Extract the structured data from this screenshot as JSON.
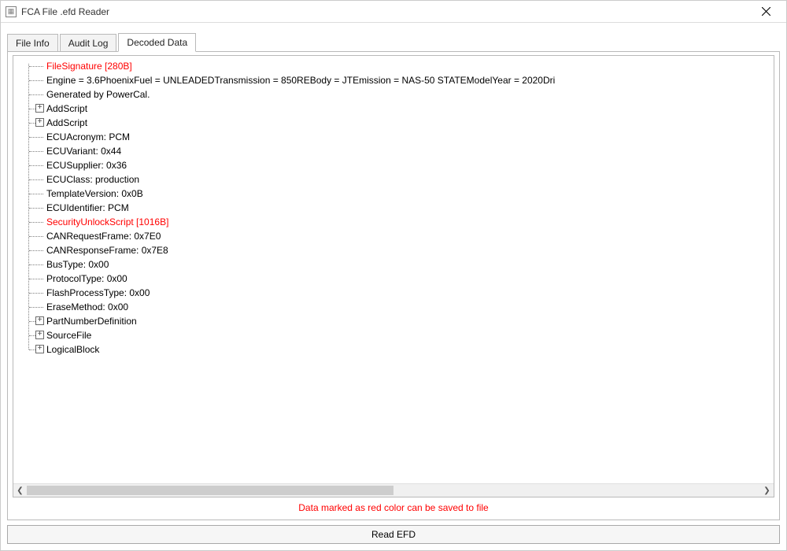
{
  "window": {
    "title": "FCA File .efd Reader"
  },
  "tabs": [
    {
      "label": "File Info",
      "active": false
    },
    {
      "label": "Audit Log",
      "active": false
    },
    {
      "label": "Decoded Data",
      "active": true
    }
  ],
  "tree": [
    {
      "text": "FileSignature [280B]",
      "red": true,
      "expandable": false
    },
    {
      "text": "Engine = 3.6PhoenixFuel = UNLEADEDTransmission = 850REBody = JTEmission = NAS-50 STATEModelYear = 2020Dri",
      "red": false,
      "expandable": false
    },
    {
      "text": "Generated by PowerCal.",
      "red": false,
      "expandable": false
    },
    {
      "text": "AddScript",
      "red": false,
      "expandable": true
    },
    {
      "text": "AddScript",
      "red": false,
      "expandable": true
    },
    {
      "text": "ECUAcronym: PCM",
      "red": false,
      "expandable": false
    },
    {
      "text": "ECUVariant: 0x44",
      "red": false,
      "expandable": false
    },
    {
      "text": "ECUSupplier: 0x36",
      "red": false,
      "expandable": false
    },
    {
      "text": "ECUClass: production",
      "red": false,
      "expandable": false
    },
    {
      "text": "TemplateVersion: 0x0B",
      "red": false,
      "expandable": false
    },
    {
      "text": "ECUIdentifier: PCM",
      "red": false,
      "expandable": false
    },
    {
      "text": "SecurityUnlockScript [1016B]",
      "red": true,
      "expandable": false
    },
    {
      "text": "CANRequestFrame: 0x7E0",
      "red": false,
      "expandable": false
    },
    {
      "text": "CANResponseFrame: 0x7E8",
      "red": false,
      "expandable": false
    },
    {
      "text": "BusType: 0x00",
      "red": false,
      "expandable": false
    },
    {
      "text": "ProtocolType: 0x00",
      "red": false,
      "expandable": false
    },
    {
      "text": "FlashProcessType: 0x00",
      "red": false,
      "expandable": false
    },
    {
      "text": "EraseMethod: 0x00",
      "red": false,
      "expandable": false
    },
    {
      "text": "PartNumberDefinition",
      "red": false,
      "expandable": true
    },
    {
      "text": "SourceFile",
      "red": false,
      "expandable": true
    },
    {
      "text": "LogicalBlock",
      "red": false,
      "expandable": true
    }
  ],
  "caption": "Data marked as red color can be saved to file",
  "buttons": {
    "read": "Read EFD"
  },
  "scrollbar": {
    "left_glyph": "❮",
    "right_glyph": "❯"
  }
}
